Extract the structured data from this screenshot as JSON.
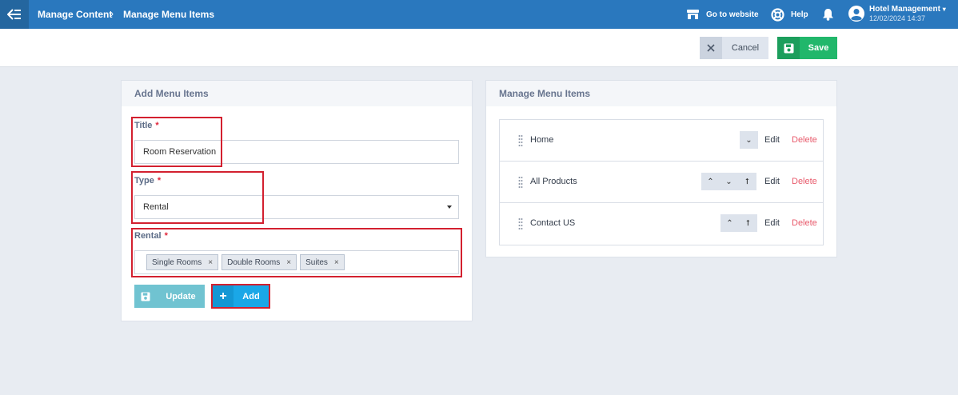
{
  "breadcrumb": {
    "section": "Manage Content",
    "page": "Manage Menu Items"
  },
  "topbar": {
    "go_to_website": "Go to website",
    "help": "Help",
    "user_name": "Hotel Management",
    "user_date": "12/02/2024 14:37"
  },
  "actions": {
    "cancel": "Cancel",
    "save": "Save"
  },
  "add_panel": {
    "title": "Add Menu Items",
    "title_label": "Title",
    "title_value": "Room Reservation",
    "type_label": "Type",
    "type_value": "Rental",
    "rental_label": "Rental",
    "required_mark": "*",
    "rental_tags": [
      "Single Rooms",
      "Double Rooms",
      "Suites"
    ],
    "tag_remove": "×",
    "update_label": "Update",
    "add_label": "Add",
    "add_icon": "+"
  },
  "manage_panel": {
    "title": "Manage Menu Items",
    "edit_label": "Edit",
    "delete_label": "Delete",
    "up_glyph": "⌃",
    "down_glyph": "⌄",
    "top_glyph": "⭡",
    "items": [
      {
        "label": "Home"
      },
      {
        "label": "All Products"
      },
      {
        "label": "Contact US"
      }
    ]
  },
  "colors": {
    "topbar": "#2a78be",
    "save": "#21b76b",
    "add": "#1aa7e7",
    "update": "#70c3d1",
    "delete": "#e85a6b",
    "highlight": "#d3202f"
  }
}
